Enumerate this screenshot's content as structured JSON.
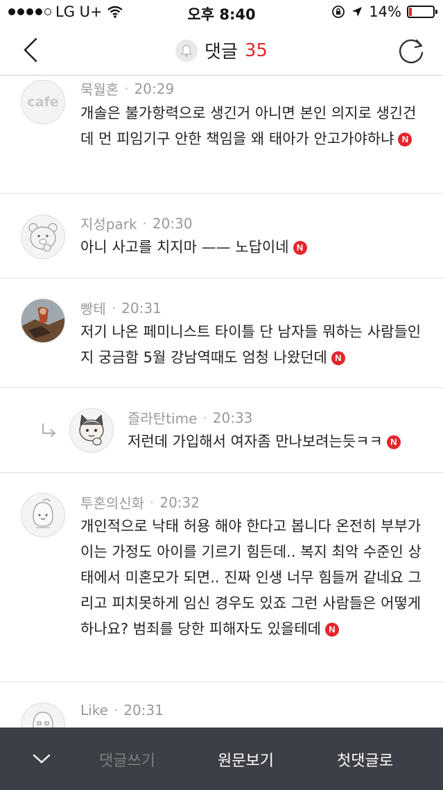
{
  "status_bar": {
    "carrier": "LG U+",
    "time": "오후 8:40",
    "battery": "14%",
    "battery_level": 0.14
  },
  "nav": {
    "title": "댓글",
    "count": "35"
  },
  "comments": [
    {
      "author": "묵월혼",
      "time": "20:29",
      "text": "개솔은 불가항력으로 생긴거 아니면 본인 의지로 생긴건데 먼 피임기구 안한 책임을 왜 태아가 안고가야하냐",
      "avatar_label": "cafe"
    },
    {
      "author": "지성park",
      "time": "20:30",
      "text": "아니 사고를 치지마 —— 노답이네"
    },
    {
      "author": "빵테",
      "time": "20:31",
      "text": "저기 나온 페미니스트 타이틀 단 남자들 뭐하는 사람들인지 궁금함 5월 강남역때도 엄청 나왔던데"
    },
    {
      "author": "즐라탄time",
      "time": "20:33",
      "text": "저런데 가입해서 여자좀 만나보려는듯ㅋㅋ",
      "is_reply": true
    },
    {
      "author": "투혼의신화",
      "time": "20:32",
      "text": "개인적으로 낙태 허용 해야 한다고 봅니다 온전히 부부가 이는 가정도 아이를 기르기 힘든데.. 복지 최악 수준인 상태에서 미혼모가 되면.. 진짜 인생 너무 힘들꺼 같네요 그리고 피치못하게 임신 경우도 있죠 그런 사람들은 어떻게 하나요? 범죄를 당한 피해자도 있을테데"
    },
    {
      "author": "Like",
      "time": "20:31",
      "text": ""
    }
  ],
  "badge_letter": "N",
  "toolbar": {
    "write": "댓글쓰기",
    "original": "원문보기",
    "first": "첫댓글로"
  },
  "colors": {
    "accent": "#e3262c",
    "toolbar_bg": "#3c3f45",
    "toolbar_disabled": "#7b7e84"
  }
}
